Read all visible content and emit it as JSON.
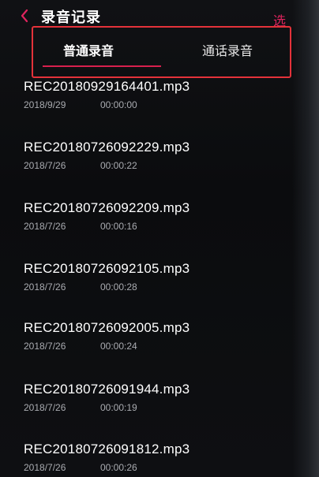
{
  "header": {
    "title": "录音记录",
    "select_label": "选"
  },
  "tabs": [
    {
      "label": "普通录音",
      "active": true
    },
    {
      "label": "通话录音",
      "active": false
    }
  ],
  "recordings": [
    {
      "name": "REC20180929164401.mp3",
      "date": "2018/9/29",
      "duration": "00:00:00"
    },
    {
      "name": "REC20180726092229.mp3",
      "date": "2018/7/26",
      "duration": "00:00:22"
    },
    {
      "name": "REC20180726092209.mp3",
      "date": "2018/7/26",
      "duration": "00:00:16"
    },
    {
      "name": "REC20180726092105.mp3",
      "date": "2018/7/26",
      "duration": "00:00:28"
    },
    {
      "name": "REC20180726092005.mp3",
      "date": "2018/7/26",
      "duration": "00:00:24"
    },
    {
      "name": "REC20180726091944.mp3",
      "date": "2018/7/26",
      "duration": "00:00:19"
    },
    {
      "name": "REC20180726091812.mp3",
      "date": "2018/7/26",
      "duration": "00:00:26"
    }
  ],
  "colors": {
    "accent": "#d8204e",
    "highlight_box": "#e4323a",
    "background": "#0d0e10"
  },
  "icons": {
    "back": "chevron-left-icon"
  }
}
